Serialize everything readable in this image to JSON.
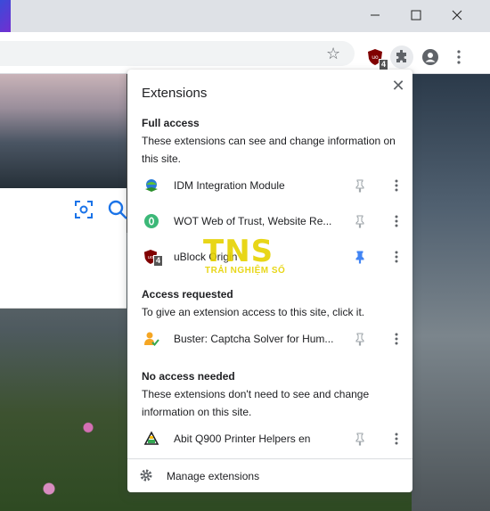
{
  "window": {
    "minimize_icon": "minimize-icon",
    "maximize_icon": "maximize-icon",
    "close_icon": "close-icon"
  },
  "toolbar": {
    "bookmark_icon": "star-icon",
    "ublock_badge": "4",
    "extensions_icon": "puzzle-icon",
    "profile_icon": "avatar-icon",
    "menu_icon": "more-vertical-icon"
  },
  "popup": {
    "title": "Extensions",
    "close_label": "✕",
    "sections": {
      "full_access": {
        "title": "Full access",
        "desc": "These extensions can see and change information on this site."
      },
      "access_requested": {
        "title": "Access requested",
        "desc": "To give an extension access to this site, click it."
      },
      "no_access": {
        "title": "No access needed",
        "desc": "These extensions don't need to see and change information on this site."
      }
    },
    "extensions": [
      {
        "name": "IDM Integration Module",
        "icon": "idm-icon",
        "pinned": false
      },
      {
        "name": "WOT Web of Trust, Website Re...",
        "icon": "wot-icon",
        "pinned": false
      },
      {
        "name": "uBlock Origin",
        "icon": "ublock-icon",
        "pinned": true,
        "badge": "4"
      },
      {
        "name": "Buster: Captcha Solver for Hum...",
        "icon": "buster-icon",
        "pinned": false
      },
      {
        "name": "Abit Q900 Printer Helpers en",
        "icon": "printer-icon",
        "pinned": false
      }
    ],
    "footer": {
      "manage_label": "Manage extensions"
    }
  },
  "watermark": {
    "big": "TNS",
    "small": "TRẢI NGHIỆM SỐ"
  },
  "colors": {
    "pin_active": "#4285f4",
    "pin_inactive": "#9aa0a6",
    "ublock_red": "#800000",
    "wot_green": "#3cb878"
  }
}
